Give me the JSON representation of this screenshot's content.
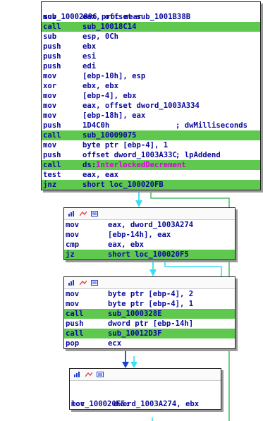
{
  "block1": {
    "title": "sub_10002096 proc near",
    "rows": [
      {
        "mn": "mov",
        "op": "eax, offset sub_1001B38B",
        "hl": false
      },
      {
        "mn": "call",
        "op": "sub_10018C14",
        "hl": true
      },
      {
        "mn": "sub",
        "op": "esp, 0Ch",
        "hl": false
      },
      {
        "mn": "push",
        "op": "ebx",
        "hl": false
      },
      {
        "mn": "push",
        "op": "esi",
        "hl": false
      },
      {
        "mn": "push",
        "op": "edi",
        "hl": false
      },
      {
        "mn": "mov",
        "op": "[ebp-10h], esp",
        "hl": false
      },
      {
        "mn": "xor",
        "op": "ebx, ebx",
        "hl": false
      },
      {
        "mn": "mov",
        "op": "[ebp-4], ebx",
        "hl": false
      },
      {
        "mn": "mov",
        "op": "eax, offset dword_1003A334",
        "hl": false
      },
      {
        "mn": "mov",
        "op": "[ebp-18h], eax",
        "hl": false
      },
      {
        "mn": "push",
        "op": "1D4C0h",
        "comment": "; dwMilliseconds",
        "hl": false
      },
      {
        "mn": "call",
        "op": "sub_10009075",
        "hl": true
      },
      {
        "mn": "mov",
        "op": "byte ptr [ebp-4], 1",
        "hl": false
      },
      {
        "mn": "push",
        "op": "offset dword_1003A33C",
        "comment": "; lpAddend",
        "hl": false
      },
      {
        "mn": "call",
        "op": "ds:",
        "api": "InterlockedDecrement",
        "hl": true
      },
      {
        "mn": "test",
        "op": "eax, eax",
        "hl": false
      },
      {
        "mn": "jnz",
        "op": "short loc_100020FB",
        "hl": true
      }
    ]
  },
  "block2": {
    "rows": [
      {
        "mn": "mov",
        "op": "eax, dword_1003A274",
        "hl": false
      },
      {
        "mn": "mov",
        "op": "[ebp-14h], eax",
        "hl": false
      },
      {
        "mn": "cmp",
        "op": "eax, ebx",
        "hl": false
      },
      {
        "mn": "jz",
        "op": "short loc_100020F5",
        "hl": true
      }
    ]
  },
  "block3": {
    "rows": [
      {
        "mn": "mov",
        "op": "byte ptr [ebp-4], 2",
        "hl": false
      },
      {
        "mn": "mov",
        "op": "byte ptr [ebp-4], 1",
        "hl": false
      },
      {
        "mn": "call",
        "op": "sub_1000328E",
        "hl": true
      },
      {
        "mn": "push",
        "op": "dword ptr [ebp-14h]",
        "hl": false
      },
      {
        "mn": "call",
        "op": "sub_10012D3F",
        "hl": true
      },
      {
        "mn": "pop",
        "op": "ecx",
        "hl": false
      }
    ]
  },
  "block4": {
    "label": "loc_100020F5:",
    "rows": [
      {
        "mn": "mov",
        "op": "dword_1003A274, ebx",
        "hl": false
      }
    ]
  },
  "colors": {
    "highlight": "#5fc84f",
    "text": "#0a0a9a",
    "api": "#e000e0",
    "edge_blue": "#1c3fd6",
    "edge_cyan": "#38dff0",
    "edge_green": "#4cc26b"
  },
  "icons": [
    "graph-color-icon",
    "graph-nodes-icon",
    "graph-text-icon"
  ]
}
